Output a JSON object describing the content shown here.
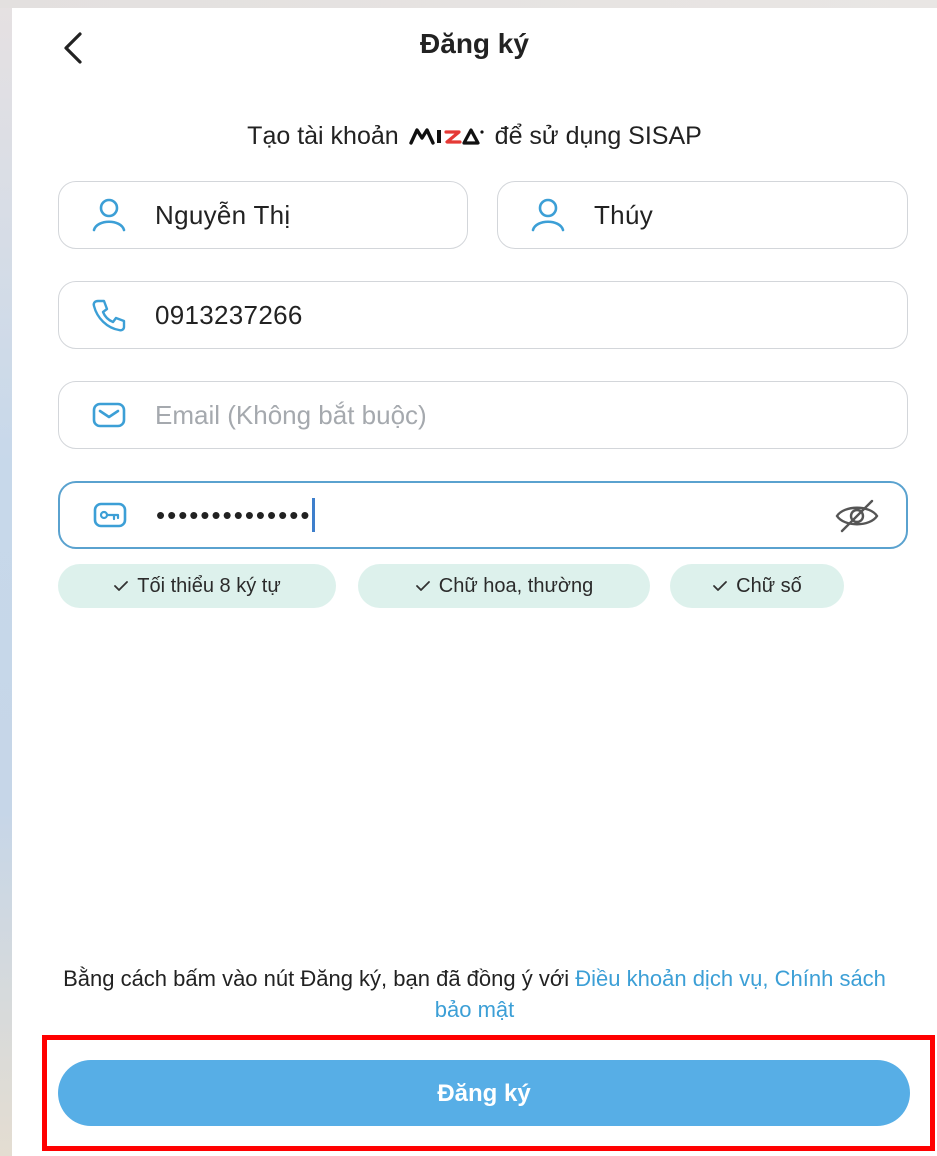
{
  "header": {
    "title": "Đăng ký",
    "back_icon": "chevron-left-icon"
  },
  "subtitle": {
    "prefix": "Tạo tài khoản",
    "brand_logo_text": "MISA",
    "suffix": "để sử dụng SISAP"
  },
  "form": {
    "last_name": {
      "value": "Nguyễn Thị",
      "icon": "person-icon"
    },
    "first_name": {
      "value": "Thúy",
      "icon": "person-icon"
    },
    "phone": {
      "value": "0913237266",
      "icon": "phone-icon"
    },
    "email": {
      "value": "",
      "placeholder": "Email (Không bắt buộc)",
      "icon": "mail-icon"
    },
    "password": {
      "masked_value": "••••••••••••••",
      "icon": "key-icon",
      "toggle_icon": "eye-off-icon"
    }
  },
  "password_rules": [
    {
      "label": "Tối thiểu 8 ký tự"
    },
    {
      "label": "Chữ hoa, thường"
    },
    {
      "label": "Chữ số"
    }
  ],
  "terms": {
    "text": "Bằng cách bấm vào nút Đăng ký, bạn đã đồng ý với",
    "link": "Điều khoản dịch vụ, Chính sách bảo mật"
  },
  "submit": {
    "label": "Đăng ký"
  },
  "colors": {
    "accent": "#57aee6",
    "icon": "#3c9fd6",
    "chip_bg": "#ddf1ec",
    "highlight": "#ff0000",
    "link": "#3c9fd6"
  }
}
